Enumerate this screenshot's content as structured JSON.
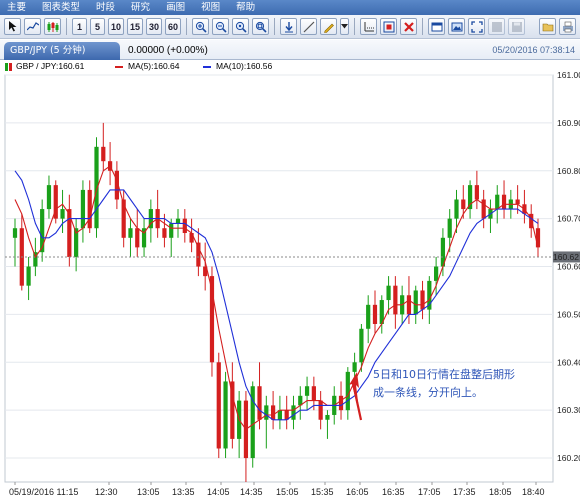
{
  "menu": [
    "主要",
    "图表类型",
    "时段",
    "研究",
    "画图",
    "视图",
    "帮助"
  ],
  "toolbar": {
    "periods": [
      "1",
      "5",
      "10",
      "15",
      "30",
      "60"
    ]
  },
  "header": {
    "tab_label": "GBP/JPY (5 分钟)",
    "change": "0.00000 (+0.00%)",
    "datetime": "05/20/2016 07:38:14"
  },
  "legend": {
    "price": "GBP / JPY:160.61",
    "ma5": "MA(5):160.64",
    "ma10": "MA(10):160.56"
  },
  "colors": {
    "up": "#1aa01a",
    "down": "#d41f1f",
    "ma5": "#d41f1f",
    "ma10": "#2030d8",
    "accent": "#3d6bb0",
    "annotation": "#2f56b8"
  },
  "price_label": "160.62",
  "annotation": {
    "line1": "5日和10日行情在盘整后期形",
    "line2": "成一条线，分开向上。"
  },
  "chart_data": {
    "type": "candlestick",
    "title": "GBP/JPY (5 分钟)",
    "ylim": [
      160.15,
      161.0
    ],
    "y_ticks": [
      160.2,
      160.3,
      160.4,
      160.5,
      160.6,
      160.7,
      160.8,
      160.9,
      161.0
    ],
    "x_tick_labels": [
      "05/19/2016 11:15",
      "12:30",
      "13:05",
      "13:35",
      "14:05",
      "14:35",
      "15:05",
      "15:35",
      "16:05",
      "16:35",
      "17:05",
      "17:35",
      "18:05",
      "18:40"
    ],
    "last_price": 160.62,
    "ohlc": [
      [
        160.66,
        160.7,
        160.6,
        160.68
      ],
      [
        160.68,
        160.71,
        160.55,
        160.56
      ],
      [
        160.56,
        160.62,
        160.53,
        160.6
      ],
      [
        160.6,
        160.66,
        160.58,
        160.63
      ],
      [
        160.63,
        160.74,
        160.61,
        160.72
      ],
      [
        160.72,
        160.79,
        160.7,
        160.77
      ],
      [
        160.77,
        160.78,
        160.69,
        160.7
      ],
      [
        160.7,
        160.76,
        160.67,
        160.72
      ],
      [
        160.72,
        160.75,
        160.6,
        160.62
      ],
      [
        160.62,
        160.7,
        160.59,
        160.68
      ],
      [
        160.68,
        160.78,
        160.65,
        160.76
      ],
      [
        160.76,
        160.78,
        160.67,
        160.68
      ],
      [
        160.68,
        160.87,
        160.66,
        160.85
      ],
      [
        160.85,
        160.9,
        160.8,
        160.82
      ],
      [
        160.82,
        160.86,
        160.77,
        160.8
      ],
      [
        160.8,
        160.82,
        160.72,
        160.74
      ],
      [
        160.74,
        160.76,
        160.64,
        160.66
      ],
      [
        160.66,
        160.7,
        160.62,
        160.68
      ],
      [
        160.68,
        160.72,
        160.62,
        160.64
      ],
      [
        160.64,
        160.7,
        160.62,
        160.68
      ],
      [
        160.68,
        160.74,
        160.65,
        160.72
      ],
      [
        160.72,
        160.76,
        160.66,
        160.68
      ],
      [
        160.68,
        160.71,
        160.64,
        160.66
      ],
      [
        160.66,
        160.7,
        160.62,
        160.69
      ],
      [
        160.69,
        160.72,
        160.66,
        160.7
      ],
      [
        160.7,
        160.72,
        160.65,
        160.67
      ],
      [
        160.67,
        160.7,
        160.63,
        160.65
      ],
      [
        160.65,
        160.68,
        160.58,
        160.6
      ],
      [
        160.6,
        160.65,
        160.55,
        160.58
      ],
      [
        160.58,
        160.6,
        160.37,
        160.4
      ],
      [
        160.4,
        160.42,
        160.2,
        160.22
      ],
      [
        160.22,
        160.38,
        160.2,
        160.36
      ],
      [
        160.36,
        160.4,
        160.22,
        160.24
      ],
      [
        160.24,
        160.34,
        160.2,
        160.32
      ],
      [
        160.32,
        160.34,
        160.15,
        160.2
      ],
      [
        160.2,
        160.36,
        160.18,
        160.35
      ],
      [
        160.35,
        160.4,
        160.26,
        160.28
      ],
      [
        160.28,
        160.33,
        160.22,
        160.31
      ],
      [
        160.31,
        160.34,
        160.26,
        160.28
      ],
      [
        160.28,
        160.33,
        160.26,
        160.3
      ],
      [
        160.3,
        160.33,
        160.26,
        160.28
      ],
      [
        160.28,
        160.33,
        160.26,
        160.31
      ],
      [
        160.31,
        160.35,
        160.28,
        160.33
      ],
      [
        160.33,
        160.37,
        160.3,
        160.35
      ],
      [
        160.35,
        160.37,
        160.3,
        160.32
      ],
      [
        160.32,
        160.34,
        160.26,
        160.28
      ],
      [
        160.28,
        160.3,
        160.24,
        160.29
      ],
      [
        160.29,
        160.35,
        160.27,
        160.33
      ],
      [
        160.33,
        160.36,
        160.28,
        160.3
      ],
      [
        160.3,
        160.39,
        160.28,
        160.38
      ],
      [
        160.38,
        160.42,
        160.36,
        160.4
      ],
      [
        160.4,
        160.48,
        160.38,
        160.47
      ],
      [
        160.47,
        160.54,
        160.44,
        160.52
      ],
      [
        160.52,
        160.55,
        160.46,
        160.48
      ],
      [
        160.48,
        160.54,
        160.46,
        160.53
      ],
      [
        160.53,
        160.58,
        160.5,
        160.56
      ],
      [
        160.56,
        160.58,
        160.47,
        160.5
      ],
      [
        160.5,
        160.56,
        160.48,
        160.54
      ],
      [
        160.54,
        160.58,
        160.48,
        160.5
      ],
      [
        160.5,
        160.56,
        160.48,
        160.55
      ],
      [
        160.55,
        160.57,
        160.49,
        160.51
      ],
      [
        160.51,
        160.58,
        160.48,
        160.57
      ],
      [
        160.57,
        160.62,
        160.54,
        160.6
      ],
      [
        160.6,
        160.68,
        160.58,
        160.66
      ],
      [
        160.66,
        160.72,
        160.63,
        160.7
      ],
      [
        160.7,
        160.76,
        160.67,
        160.74
      ],
      [
        160.74,
        160.77,
        160.7,
        160.72
      ],
      [
        160.72,
        160.78,
        160.7,
        160.77
      ],
      [
        160.77,
        160.8,
        160.72,
        160.74
      ],
      [
        160.74,
        160.76,
        160.68,
        160.7
      ],
      [
        160.7,
        160.74,
        160.67,
        160.72
      ],
      [
        160.72,
        160.77,
        160.69,
        160.75
      ],
      [
        160.75,
        160.78,
        160.7,
        160.72
      ],
      [
        160.72,
        160.76,
        160.7,
        160.74
      ],
      [
        160.74,
        160.77,
        160.71,
        160.73
      ],
      [
        160.73,
        160.76,
        160.69,
        160.71
      ],
      [
        160.71,
        160.73,
        160.66,
        160.68
      ],
      [
        160.68,
        160.7,
        160.62,
        160.64
      ]
    ],
    "series": [
      {
        "name": "MA(5)",
        "values": [
          160.74,
          160.71,
          160.66,
          160.62,
          160.64,
          160.68,
          160.72,
          160.73,
          160.71,
          160.67,
          160.68,
          160.7,
          160.76,
          160.8,
          160.81,
          160.78,
          160.73,
          160.7,
          160.68,
          160.67,
          160.69,
          160.7,
          160.69,
          160.68,
          160.68,
          160.68,
          160.67,
          160.64,
          160.61,
          160.55,
          160.47,
          160.4,
          160.33,
          160.28,
          160.26,
          160.27,
          160.28,
          160.29,
          160.29,
          160.3,
          160.3,
          160.3,
          160.31,
          160.32,
          160.32,
          160.32,
          160.31,
          160.31,
          160.32,
          160.33,
          160.36,
          160.39,
          160.43,
          160.46,
          160.48,
          160.51,
          160.52,
          160.52,
          160.53,
          160.52,
          160.52,
          160.53,
          160.56,
          160.6,
          160.64,
          160.68,
          160.71,
          160.73,
          160.74,
          160.73,
          160.72,
          160.72,
          160.73,
          160.73,
          160.73,
          160.72,
          160.7,
          160.64
        ]
      },
      {
        "name": "MA(10)",
        "values": [
          160.8,
          160.78,
          160.74,
          160.69,
          160.66,
          160.66,
          160.67,
          160.69,
          160.7,
          160.7,
          160.7,
          160.7,
          160.72,
          160.74,
          160.76,
          160.76,
          160.76,
          160.74,
          160.72,
          160.7,
          160.7,
          160.7,
          160.7,
          160.69,
          160.69,
          160.69,
          160.68,
          160.67,
          160.66,
          160.63,
          160.58,
          160.52,
          160.46,
          160.4,
          160.35,
          160.32,
          160.3,
          160.29,
          160.28,
          160.28,
          160.28,
          160.29,
          160.3,
          160.3,
          160.31,
          160.31,
          160.31,
          160.31,
          160.31,
          160.32,
          160.33,
          160.35,
          160.37,
          160.4,
          160.42,
          160.44,
          160.46,
          160.48,
          160.5,
          160.5,
          160.51,
          160.52,
          160.54,
          160.56,
          160.58,
          160.61,
          160.64,
          160.67,
          160.69,
          160.7,
          160.71,
          160.72,
          160.72,
          160.72,
          160.72,
          160.71,
          160.7,
          160.69
        ]
      }
    ]
  }
}
